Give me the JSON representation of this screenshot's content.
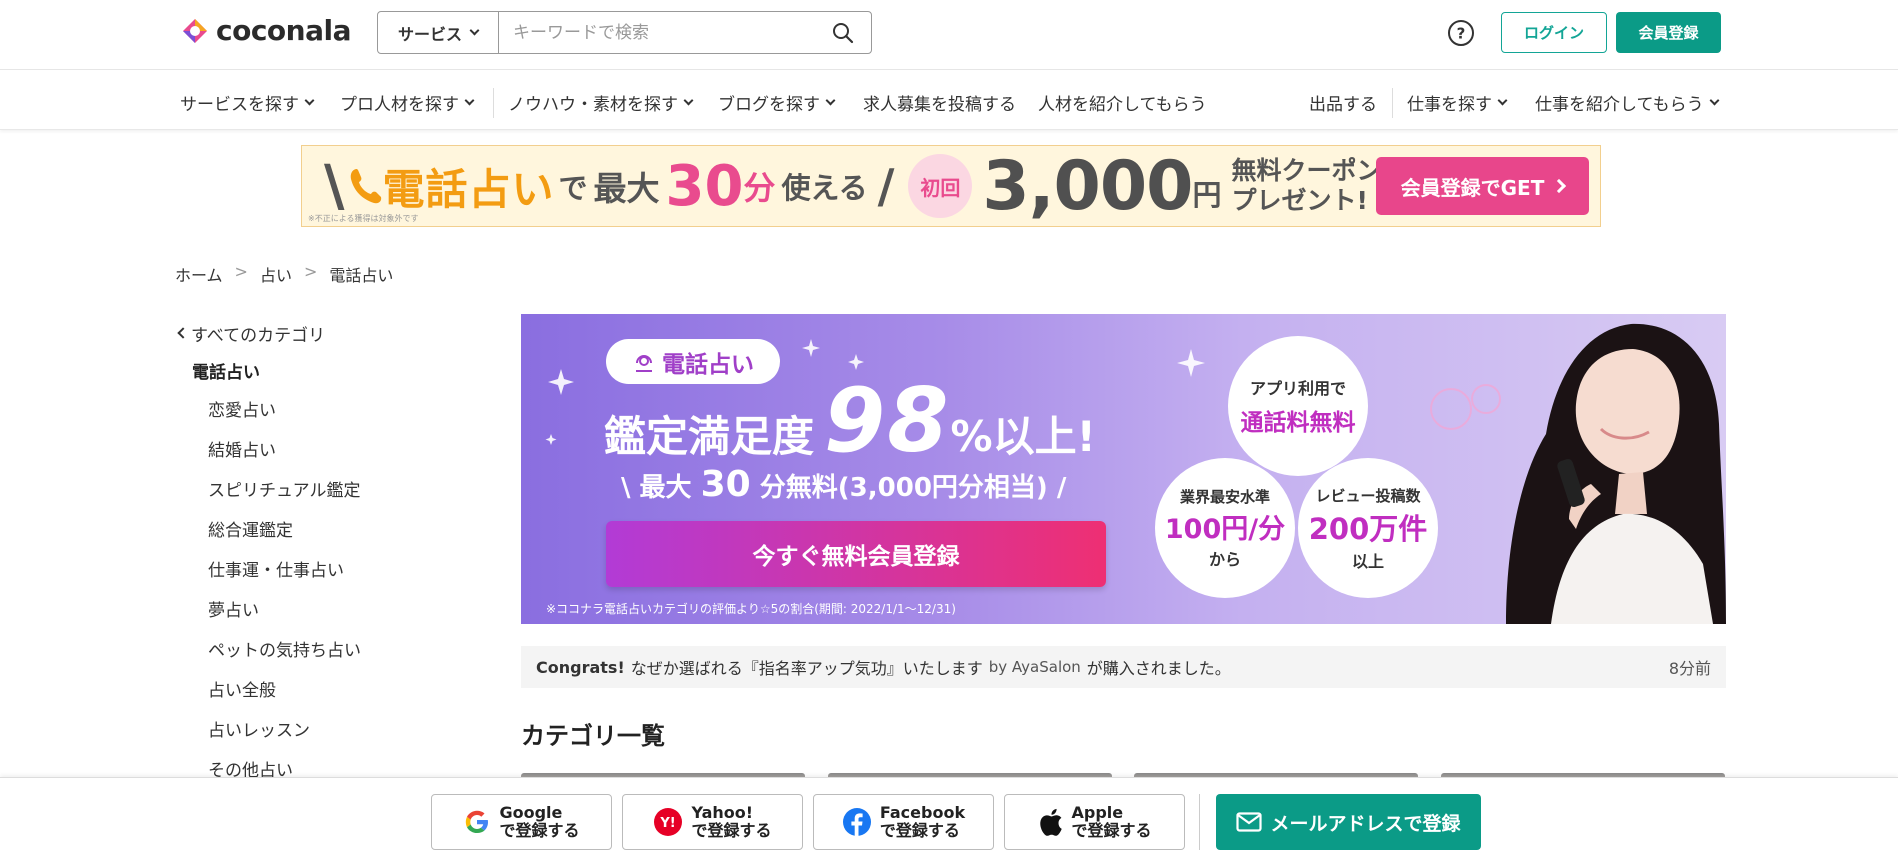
{
  "header": {
    "logo_text": "coconala",
    "search_category": "サービス",
    "search_placeholder": "キーワードで検索",
    "login_label": "ログイン",
    "signup_label": "会員登録"
  },
  "nav": {
    "left": [
      {
        "label": "サービスを探す",
        "dropdown": true
      },
      {
        "label": "プロ人材を探す",
        "dropdown": true
      },
      {
        "label": "ノウハウ・素材を探す",
        "dropdown": true
      },
      {
        "label": "ブログを探す",
        "dropdown": true
      },
      {
        "label": "求人募集を投稿する",
        "dropdown": false
      },
      {
        "label": "人材を紹介してもらう",
        "dropdown": false
      }
    ],
    "right": [
      {
        "label": "出品する",
        "dropdown": false
      },
      {
        "label": "仕事を探す",
        "dropdown": true
      },
      {
        "label": "仕事を紹介してもらう",
        "dropdown": true
      }
    ]
  },
  "promo": {
    "phone_text": "電話占い",
    "de": "で",
    "max": "最大",
    "minutes": "30",
    "minutes_unit": "分",
    "usable": "使える",
    "first": "初回",
    "amount": "3,000",
    "yen": "円",
    "coupon_line1": "無料クーポン",
    "coupon_line2": "プレゼント!",
    "cta": "会員登録でGET",
    "note": "※不正による獲得は対象外です"
  },
  "breadcrumb": [
    "ホーム",
    "占い",
    "電話占い"
  ],
  "sidebar": {
    "back_label": "すべてのカテゴリ",
    "current": "電話占い",
    "items": [
      "恋愛占い",
      "結婚占い",
      "スピリチュアル鑑定",
      "総合運鑑定",
      "仕事運・仕事占い",
      "夢占い",
      "ペットの気持ち占い",
      "占い全般",
      "占いレッスン",
      "その他占い"
    ]
  },
  "hero": {
    "tag": "電話占い",
    "title_prefix": "鑑定満足度",
    "title_number": "98",
    "title_suffix": "%以上!",
    "sub_prefix": "\\ 最大",
    "sub_number": "30",
    "sub_suffix": "分無料(3,000円分相当) /",
    "cta": "今すぐ無料会員登録",
    "note": "※ココナラ電話占いカテゴリの評価より☆5の割合(期間: 2022/1/1〜12/31)",
    "circle_app_line1": "アプリ利用で",
    "circle_app_line2": "通話料無料",
    "circle_price_line1": "業界最安水準",
    "circle_price_line2": "100円/分",
    "circle_price_line3": "から",
    "circle_review_line1": "レビュー投稿数",
    "circle_review_line2": "200万件",
    "circle_review_line3": "以上"
  },
  "congrats": {
    "label": "Congrats!",
    "text": "なぜか選ばれる『指名率アップ気功』いたします",
    "by": "by AyaSalon",
    "suffix": "が購入されました。",
    "time": "8分前"
  },
  "category_title": "カテゴリ一覧",
  "bottombar": {
    "google": {
      "name": "Google",
      "action": "で登録する"
    },
    "yahoo": {
      "name": "Yahoo!",
      "action": "で登録する"
    },
    "facebook": {
      "name": "Facebook",
      "action": "で登録する"
    },
    "apple": {
      "name": "Apple",
      "action": "で登録する"
    },
    "mail": "メールアドレスで登録"
  },
  "colors": {
    "brand_green": "#0b9b87",
    "promo_pink": "#e8468b",
    "promo_orange": "#f39c12"
  }
}
